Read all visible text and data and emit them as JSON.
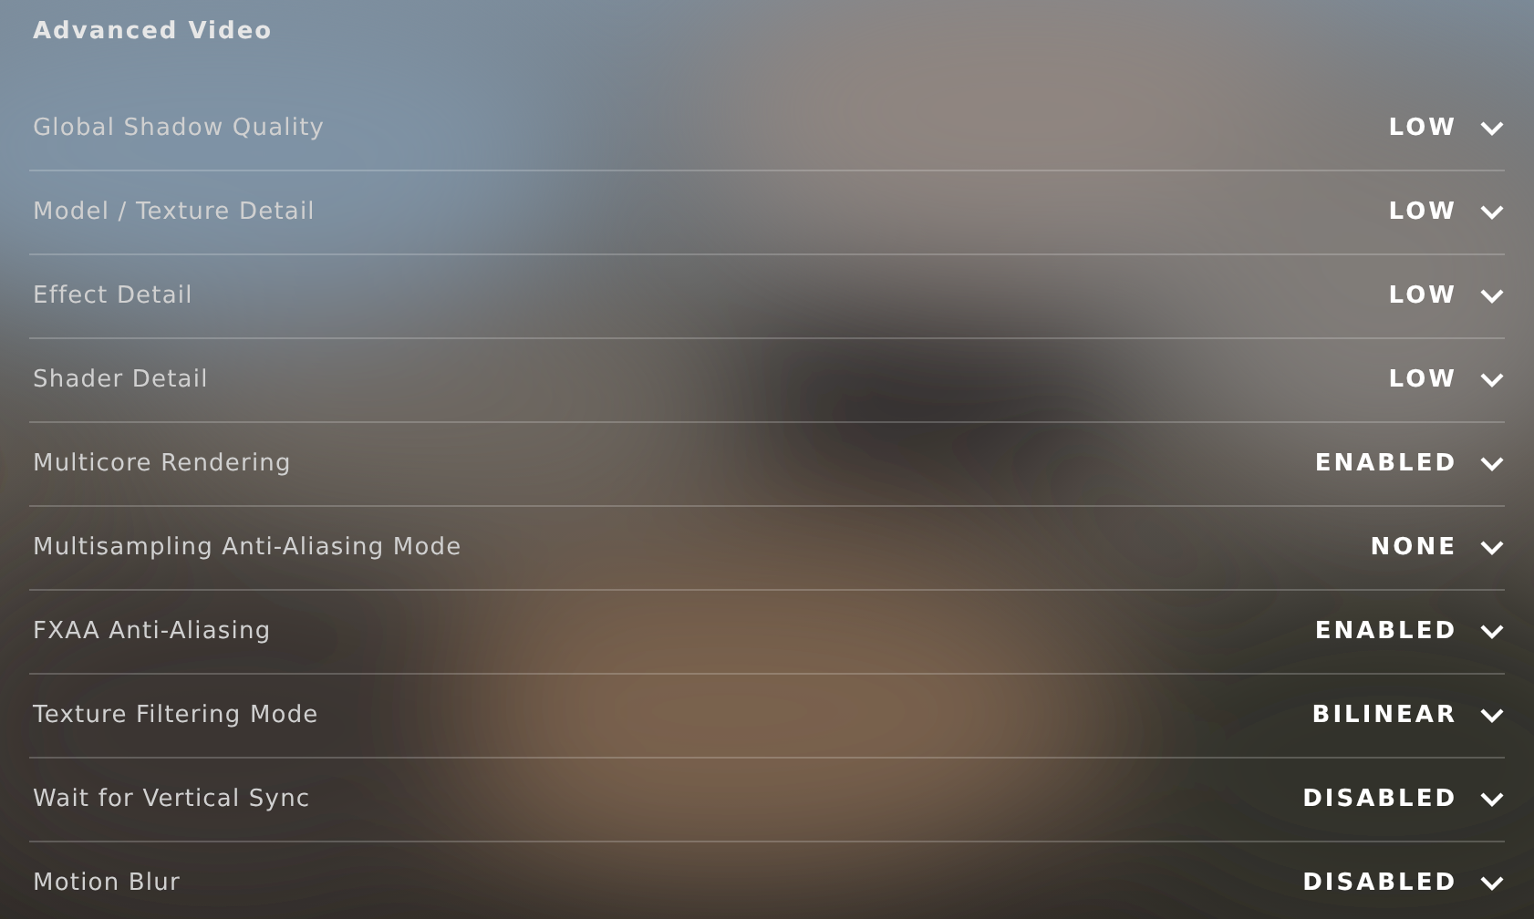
{
  "section": {
    "title": "Advanced Video"
  },
  "settings": [
    {
      "label": "Global Shadow Quality",
      "value": "LOW"
    },
    {
      "label": "Model / Texture Detail",
      "value": "LOW"
    },
    {
      "label": "Effect Detail",
      "value": "LOW"
    },
    {
      "label": "Shader Detail",
      "value": "LOW"
    },
    {
      "label": "Multicore Rendering",
      "value": "ENABLED"
    },
    {
      "label": "Multisampling Anti-Aliasing Mode",
      "value": "NONE"
    },
    {
      "label": "FXAA Anti-Aliasing",
      "value": "ENABLED"
    },
    {
      "label": "Texture Filtering Mode",
      "value": "BILINEAR"
    },
    {
      "label": "Wait for Vertical Sync",
      "value": "DISABLED"
    },
    {
      "label": "Motion Blur",
      "value": "DISABLED"
    }
  ]
}
